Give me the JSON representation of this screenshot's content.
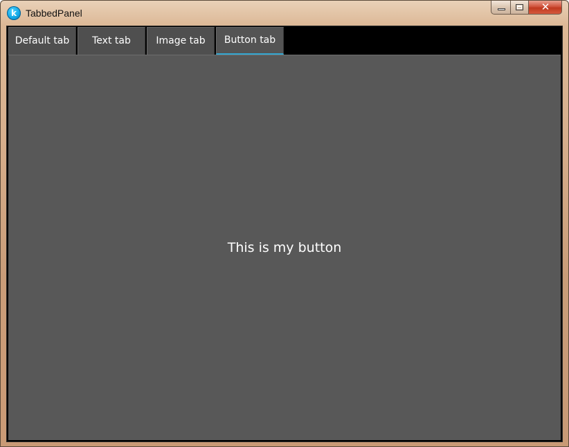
{
  "window": {
    "title": "TabbedPanel",
    "app_icon_letter": "k"
  },
  "window_controls": {
    "minimize_icon": "minimize-icon",
    "maximize_icon": "maximize-icon",
    "close_symbol": "✕"
  },
  "tabs": [
    {
      "label": "Default tab",
      "active": false
    },
    {
      "label": "Text tab",
      "active": false
    },
    {
      "label": "Image tab",
      "active": false
    },
    {
      "label": "Button tab",
      "active": true
    }
  ],
  "content": {
    "button_label": "This is my button"
  },
  "colors": {
    "tab_active_indicator": "#33a8d3",
    "content_background": "#585858",
    "tabstrip_background": "#000000"
  }
}
